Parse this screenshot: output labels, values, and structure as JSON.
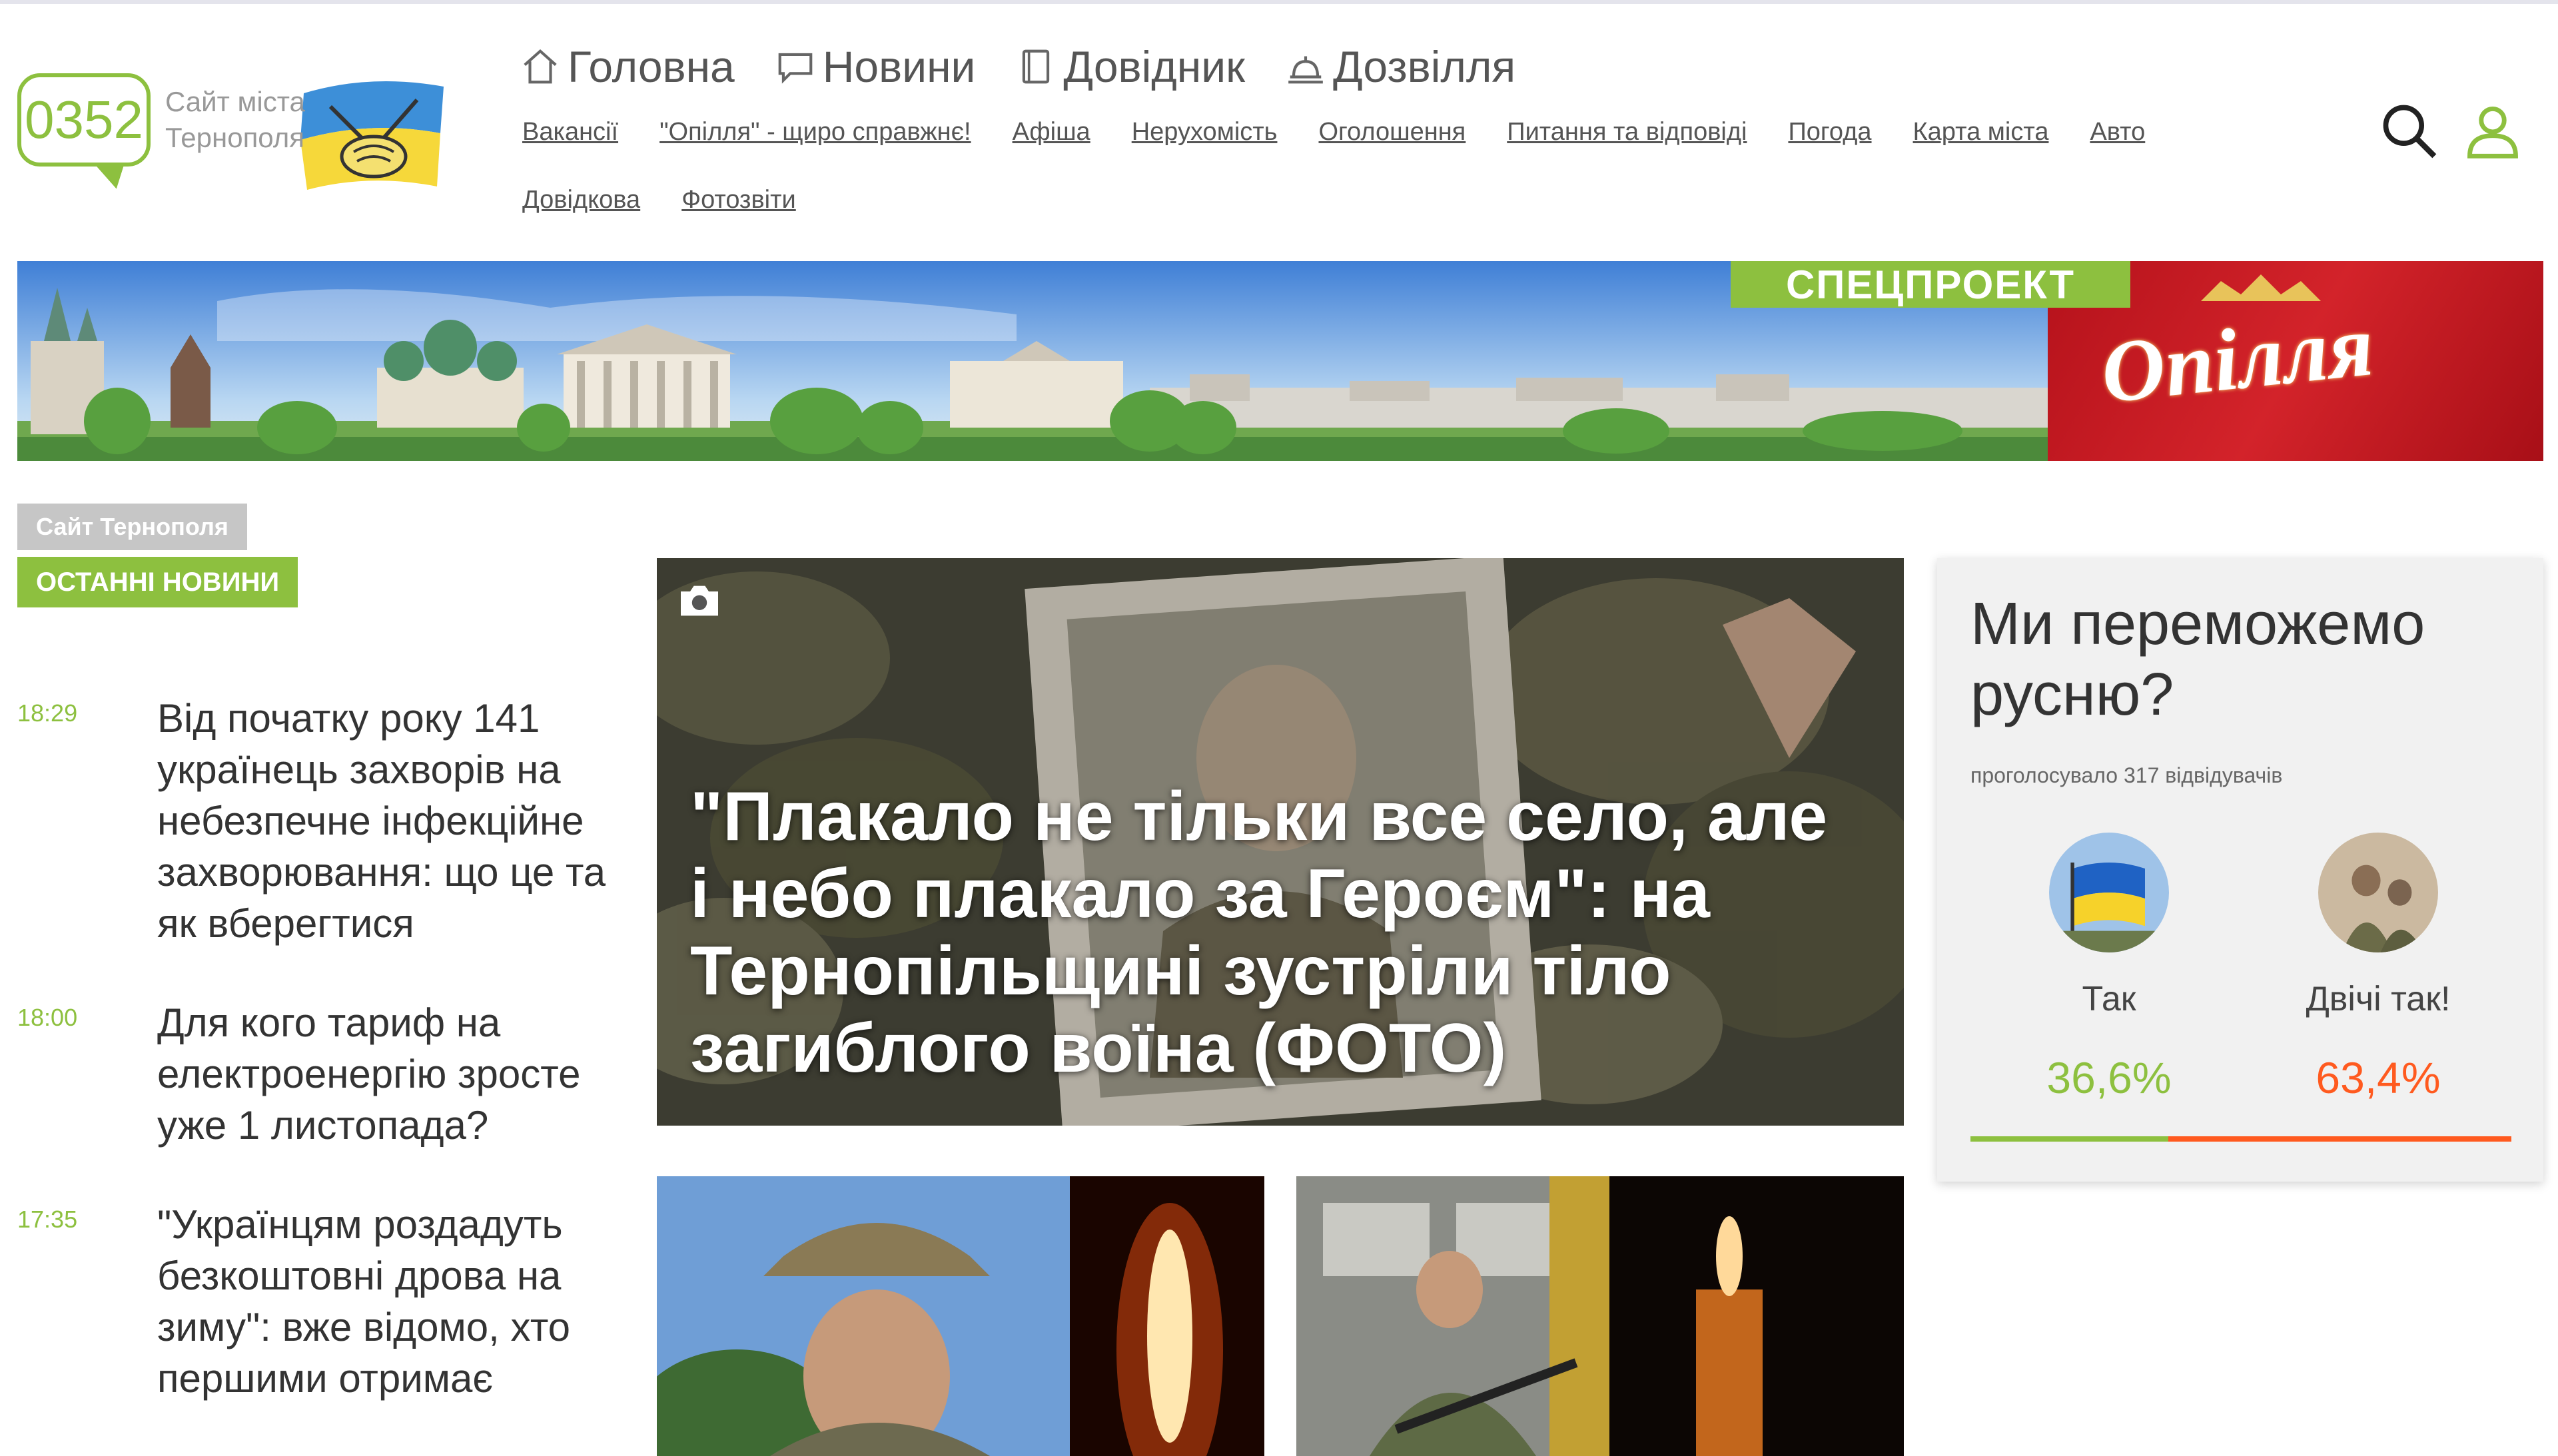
{
  "colors": {
    "accent": "#8dc03f",
    "orange": "#ff5a1f",
    "brand_red": "#c3161f"
  },
  "logo": {
    "code": "0352",
    "tagline": "Сайт міста Тернополя"
  },
  "nav": {
    "main": [
      {
        "label": "Головна",
        "icon": "home-icon"
      },
      {
        "label": "Новини",
        "icon": "chat-bubble-icon"
      },
      {
        "label": "Довідник",
        "icon": "book-icon"
      },
      {
        "label": "Дозвілля",
        "icon": "food-tray-icon"
      }
    ],
    "sub": [
      "Вакансії",
      "\"Опілля\" - щиро справжнє!",
      "Афіша",
      "Нерухомість",
      "Оголошення",
      "Питання та відповіді",
      "Погода",
      "Карта міста",
      "Авто",
      "Довідкова",
      "Фотозвіти"
    ]
  },
  "header_icons": [
    "search-icon",
    "user-icon"
  ],
  "banner": {
    "label": "СПЕЦПРОЕКТ",
    "brand": "Опілля"
  },
  "left": {
    "site_tag": "Сайт Тернополя",
    "section_tag": "ОСТАННІ НОВИНИ",
    "news": [
      {
        "time": "18:29",
        "title": "Від початку року 141 українець захворів на небезпечне інфекційне захворювання: що це та як вберегтися"
      },
      {
        "time": "18:00",
        "title": "Для кого тариф на електроенергію зросте уже 1 листопада?"
      },
      {
        "time": "17:35",
        "title": "\"Українцям роздадуть безкоштовні дрова на зиму\": вже відомо, хто першими отримає"
      }
    ]
  },
  "feature": {
    "icon": "camera-icon",
    "title": "\"Плакало не тільки все село, але і небо плакало за Героєм\": на Тернопільщині зустріли тіло загиблого воїна (ФОТО)"
  },
  "poll": {
    "question": "Ми переможемо русню?",
    "votes": "проголосувало 317 відвідувачів",
    "options": [
      {
        "label": "Так",
        "percent": "36,6%",
        "share": 36.6,
        "color": "#8dc03f"
      },
      {
        "label": "Двічі так!",
        "percent": "63,4%",
        "share": 63.4,
        "color": "#ff5a1f"
      }
    ]
  }
}
